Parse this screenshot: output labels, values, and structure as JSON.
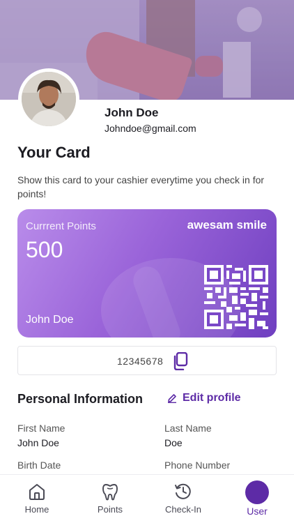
{
  "profile": {
    "name": "John Doe",
    "email": "Johndoe@gmail.com"
  },
  "card_section": {
    "title": "Your Card",
    "description": "Show this card to your cashier everytime you check in for points!"
  },
  "loyalty_card": {
    "points_label": "Currrent Points",
    "points_value": "500",
    "brand": "awesam smile",
    "holder_name": "John  Doe",
    "card_number": "12345678"
  },
  "personal_info": {
    "title": "Personal Information",
    "edit_label": "Edit profile",
    "fields": {
      "first_name_label": "First Name",
      "first_name_value": "John Doe",
      "last_name_label": "Last Name",
      "last_name_value": "Doe",
      "birth_date_label": "Birth Date",
      "phone_label": "Phone Number"
    }
  },
  "tabbar": {
    "home": "Home",
    "points": "Points",
    "checkin": "Check-In",
    "user": "User"
  },
  "colors": {
    "accent": "#5d2ba6",
    "card_gradient_start": "#b98cea",
    "card_gradient_end": "#6f3fc0"
  },
  "icons": {
    "edit": "pencil-icon",
    "copy": "copy-icon",
    "home": "house-icon",
    "points": "tooth-icon",
    "checkin": "clock-icon",
    "user": "user-icon"
  }
}
